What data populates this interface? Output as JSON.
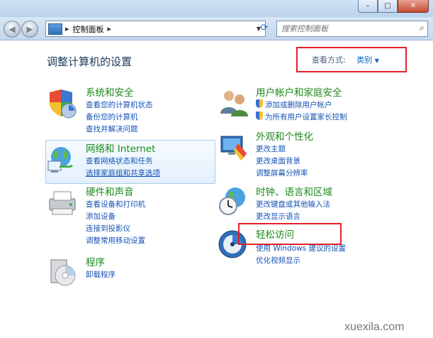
{
  "window": {
    "minimize": "–",
    "maximize": "□",
    "close": "✕"
  },
  "address": {
    "path": "控制面板",
    "separator": "▸"
  },
  "search": {
    "placeholder": "搜索控制面板"
  },
  "page": {
    "title": "调整计算机的设置"
  },
  "view_by": {
    "label": "查看方式:",
    "value": "类别"
  },
  "categories": {
    "system": {
      "title": "系统和安全",
      "links": [
        "查看您的计算机状态",
        "备份您的计算机",
        "查找并解决问题"
      ]
    },
    "network": {
      "title": "网络和 Internet",
      "links": [
        "查看网络状态和任务",
        "选择家庭组和共享选项"
      ]
    },
    "hardware": {
      "title": "硬件和声音",
      "links": [
        "查看设备和打印机",
        "添加设备",
        "连接到投影仪",
        "调整常用移动设置"
      ]
    },
    "programs": {
      "title": "程序",
      "links": [
        "卸载程序"
      ]
    },
    "users": {
      "title": "用户帐户和家庭安全",
      "links": [
        "添加或删除用户帐户",
        "为所有用户设置家长控制"
      ]
    },
    "appearance": {
      "title": "外观和个性化",
      "links": [
        "更改主题",
        "更改桌面背景",
        "调整屏幕分辨率"
      ]
    },
    "clock": {
      "title": "时钟、语言和区域",
      "links": [
        "更改键盘或其他输入法",
        "更改显示语言"
      ]
    },
    "ease": {
      "title": "轻松访问",
      "links": [
        "使用 Windows 建议的设置",
        "优化视频显示"
      ]
    }
  },
  "watermark": {
    "left": "xuexila",
    "dot": ".",
    "right": "com"
  }
}
